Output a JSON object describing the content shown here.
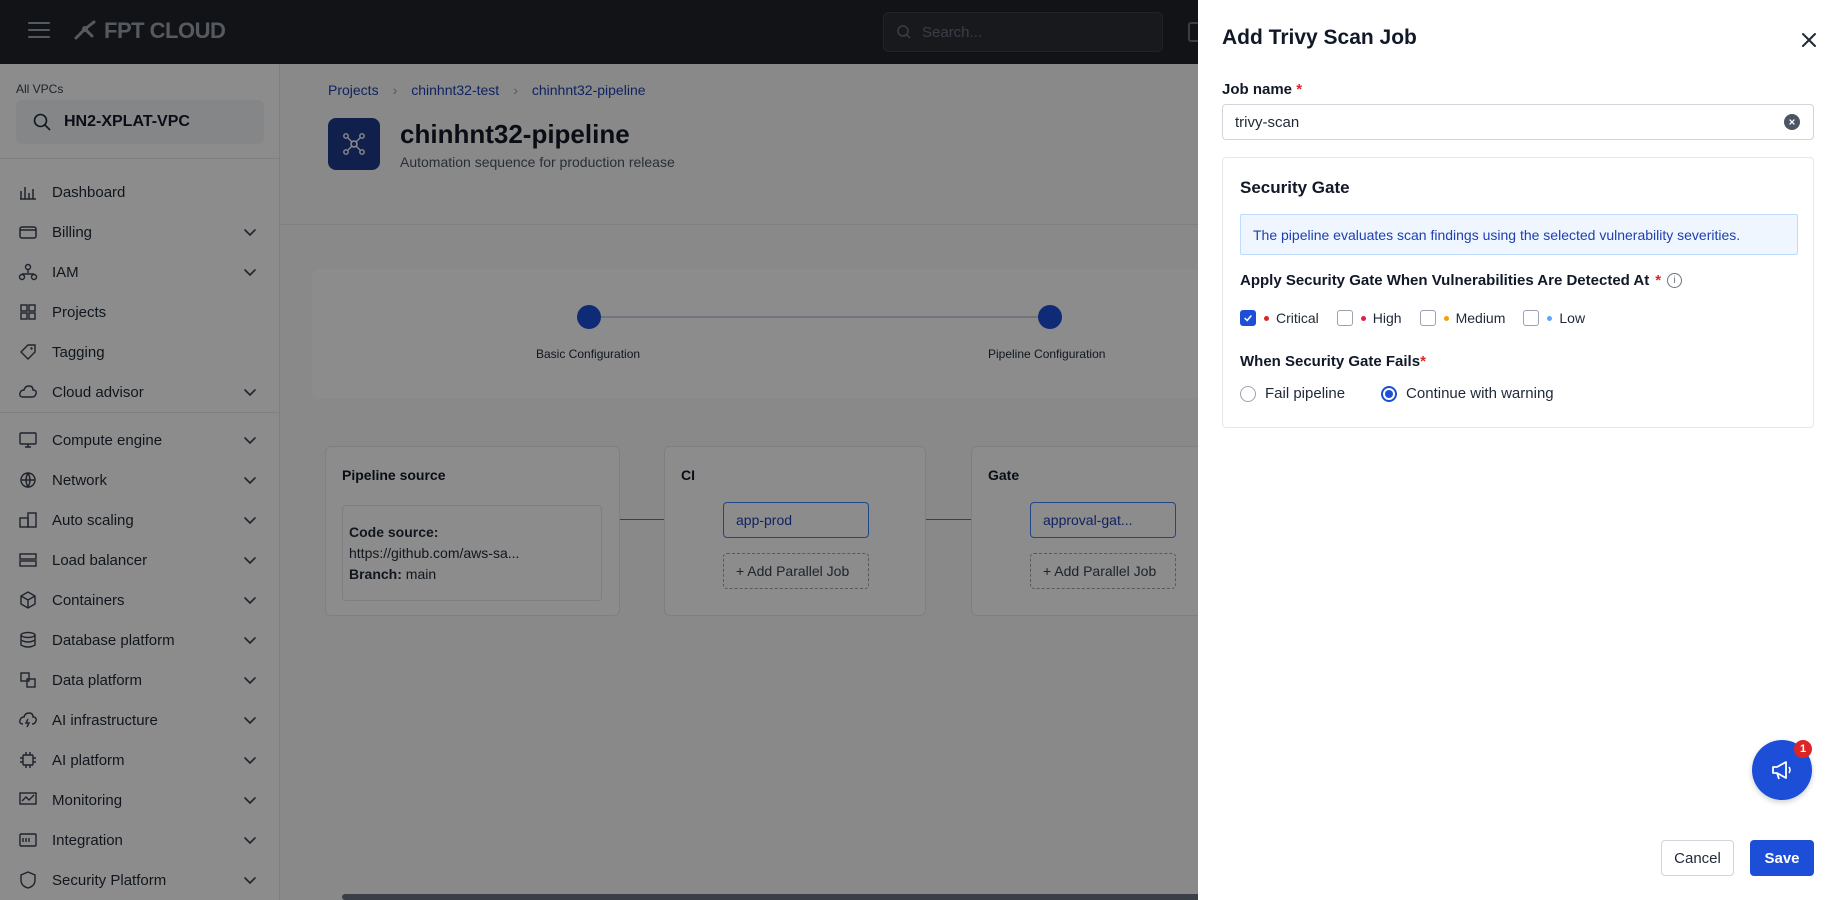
{
  "topbar": {
    "brand": "FPT CLOUD",
    "search_placeholder": "Search..."
  },
  "sidebar": {
    "vpc_label": "All VPCs",
    "vpc_value": "HN2-XPLAT-VPC",
    "items": [
      {
        "label": "Dashboard",
        "icon": "dashboard-icon",
        "expandable": false
      },
      {
        "label": "Billing",
        "icon": "billing-icon",
        "expandable": true
      },
      {
        "label": "IAM",
        "icon": "iam-icon",
        "expandable": true
      },
      {
        "label": "Projects",
        "icon": "projects-icon",
        "expandable": false
      },
      {
        "label": "Tagging",
        "icon": "tag-icon",
        "expandable": false
      },
      {
        "label": "Cloud advisor",
        "icon": "cloud-advisor-icon",
        "expandable": true
      },
      {
        "label": "Compute engine",
        "icon": "compute-icon",
        "expandable": true
      },
      {
        "label": "Network",
        "icon": "network-icon",
        "expandable": true
      },
      {
        "label": "Auto scaling",
        "icon": "auto-scaling-icon",
        "expandable": true
      },
      {
        "label": "Load balancer",
        "icon": "load-balancer-icon",
        "expandable": true
      },
      {
        "label": "Containers",
        "icon": "containers-icon",
        "expandable": true
      },
      {
        "label": "Database platform",
        "icon": "database-icon",
        "expandable": true
      },
      {
        "label": "Data platform",
        "icon": "data-platform-icon",
        "expandable": true
      },
      {
        "label": "AI infrastructure",
        "icon": "ai-infra-icon",
        "expandable": true
      },
      {
        "label": "AI platform",
        "icon": "ai-platform-icon",
        "expandable": true
      },
      {
        "label": "Monitoring",
        "icon": "monitoring-icon",
        "expandable": true
      },
      {
        "label": "Integration",
        "icon": "integration-icon",
        "expandable": true
      },
      {
        "label": "Security Platform",
        "icon": "security-icon",
        "expandable": true
      }
    ]
  },
  "main": {
    "breadcrumb": [
      "Projects",
      "chinhnt32-test",
      "chinhnt32-pipeline"
    ],
    "title": "chinhnt32-pipeline",
    "subtitle": "Automation sequence for production release",
    "steps": [
      "Basic Configuration",
      "Pipeline Configuration"
    ],
    "stages": {
      "source": {
        "title": "Pipeline source",
        "code_source_label": "Code source:",
        "code_source_value": "https://github.com/aws-sa...",
        "branch_label": "Branch:",
        "branch_value": "main"
      },
      "ci": {
        "title": "CI",
        "job": "app-prod",
        "add_label": "+ Add Parallel Job"
      },
      "gate": {
        "title": "Gate",
        "job": "approval-gat...",
        "add_label": "+ Add Parallel Job"
      }
    }
  },
  "drawer": {
    "title": "Add Trivy Scan Job",
    "job_name_label": "Job name",
    "job_name_value": "trivy-scan",
    "gate_title": "Security Gate",
    "gate_info": "The pipeline evaluates scan findings using the selected vulnerability severities.",
    "gate_question": "Apply Security Gate When Vulnerabilities Are Detected At",
    "severities": [
      {
        "label": "Critical",
        "checked": true,
        "color": "#dc2626"
      },
      {
        "label": "High",
        "checked": false,
        "color": "#e11d48"
      },
      {
        "label": "Medium",
        "checked": false,
        "color": "#f59e0b"
      },
      {
        "label": "Low",
        "checked": false,
        "color": "#60a5fa"
      }
    ],
    "fails_label": "When Security Gate Fails",
    "fail_options": [
      {
        "label": "Fail pipeline",
        "selected": false
      },
      {
        "label": "Continue with warning",
        "selected": true
      }
    ],
    "cancel_label": "Cancel",
    "save_label": "Save",
    "notification_count": "1"
  },
  "colors": {
    "accent": "#1d4ed8",
    "topbar": "#1f2328",
    "required": "#dc2626"
  }
}
